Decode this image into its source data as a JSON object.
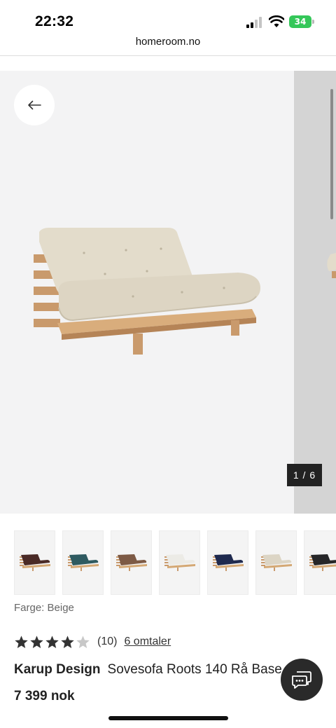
{
  "status_bar": {
    "time": "22:32",
    "battery_level": "34",
    "icons": [
      "signal-icon",
      "wifi-icon",
      "battery-icon"
    ]
  },
  "browser": {
    "url": "homeroom.no"
  },
  "gallery": {
    "counter": "1 / 6",
    "back_icon": "arrow-left-icon",
    "thumbnail_colors": [
      "#4a2a26",
      "#2e5a60",
      "#7d5a45",
      "#ecebe6",
      "#1f2a4f",
      "#dcd5c5",
      "#262628"
    ]
  },
  "product": {
    "color_label": "Farge: Beige",
    "rating_stars": 4,
    "rating_max": 5,
    "rating_count": "(10)",
    "reviews_link": "6 omtaler",
    "brand": "Karup Design",
    "name": "Sovesofa Roots 140 Rå Base",
    "price": "7 399 nok"
  },
  "chat": {
    "icon": "chat-icon"
  },
  "colors": {
    "star_filled": "#333333",
    "star_empty": "#c8c8c8",
    "battery": "#34c759"
  }
}
